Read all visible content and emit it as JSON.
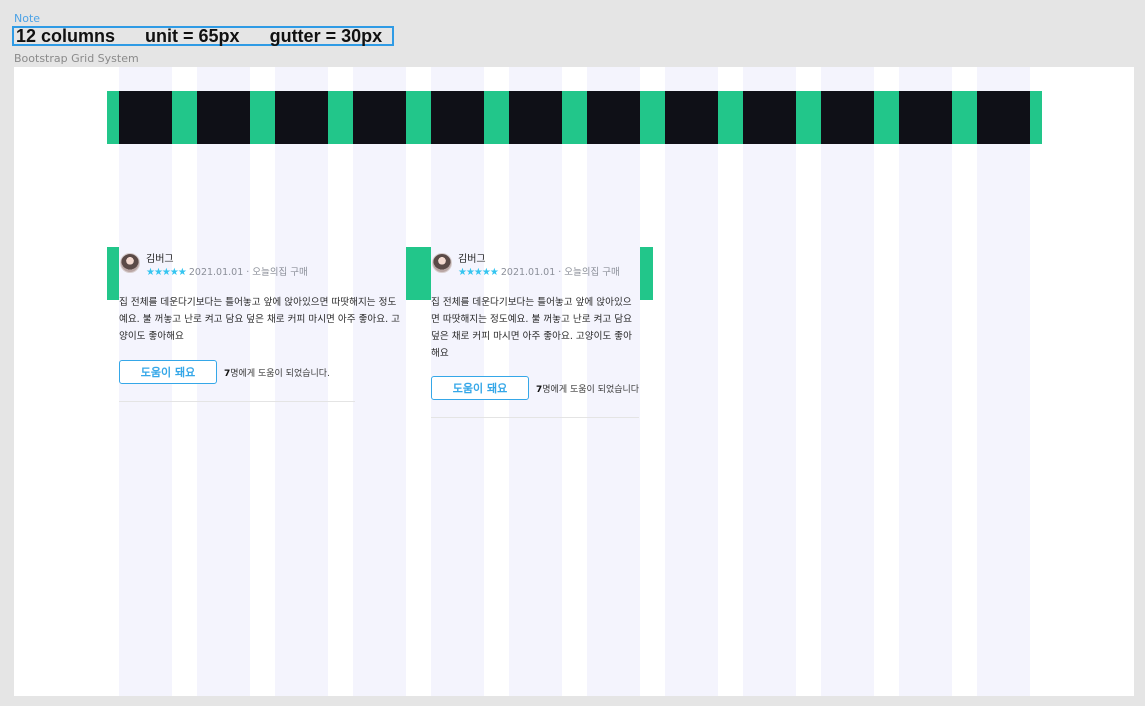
{
  "note": {
    "label": "Note",
    "text": "12 columns      unit = 65px      gutter = 30px"
  },
  "frame": {
    "label": "Bootstrap Grid System"
  },
  "colors": {
    "gutter": "#22c68a",
    "unit": "#0f1017",
    "column_overlay": "#f4f4fd",
    "accent_blue": "#35a7e8",
    "star": "#35c5f0"
  },
  "reviews": [
    {
      "author": "김버그",
      "stars": "★★★★★",
      "meta": "2021.01.01 · 오늘의집 구매",
      "body": "집 전체를 데운다기보다는 틀어놓고 앞에 앉아있으면 따땃해지는 정도예요. 불 꺼놓고 난로 켜고 담요 덮은 채로 커피 마시면 아주 좋아요. 고양이도 좋아해요",
      "button": "도움이 돼요",
      "helped_count": "7",
      "helped_text": "명에게 도움이 되었습니다."
    },
    {
      "author": "김버그",
      "stars": "★★★★★",
      "meta": "2021.01.01 · 오늘의집 구매",
      "body": "집 전체를 데운다기보다는 틀어놓고 앞에 앉아있으면 따땃해지는 정도예요. 불 꺼놓고 난로 켜고 담요 덮은 채로 커피 마시면 아주 좋아요. 고양이도 좋아해요",
      "button": "도움이 돼요",
      "helped_count": "7",
      "helped_text": "명에게 도움이 되었습니다."
    }
  ]
}
